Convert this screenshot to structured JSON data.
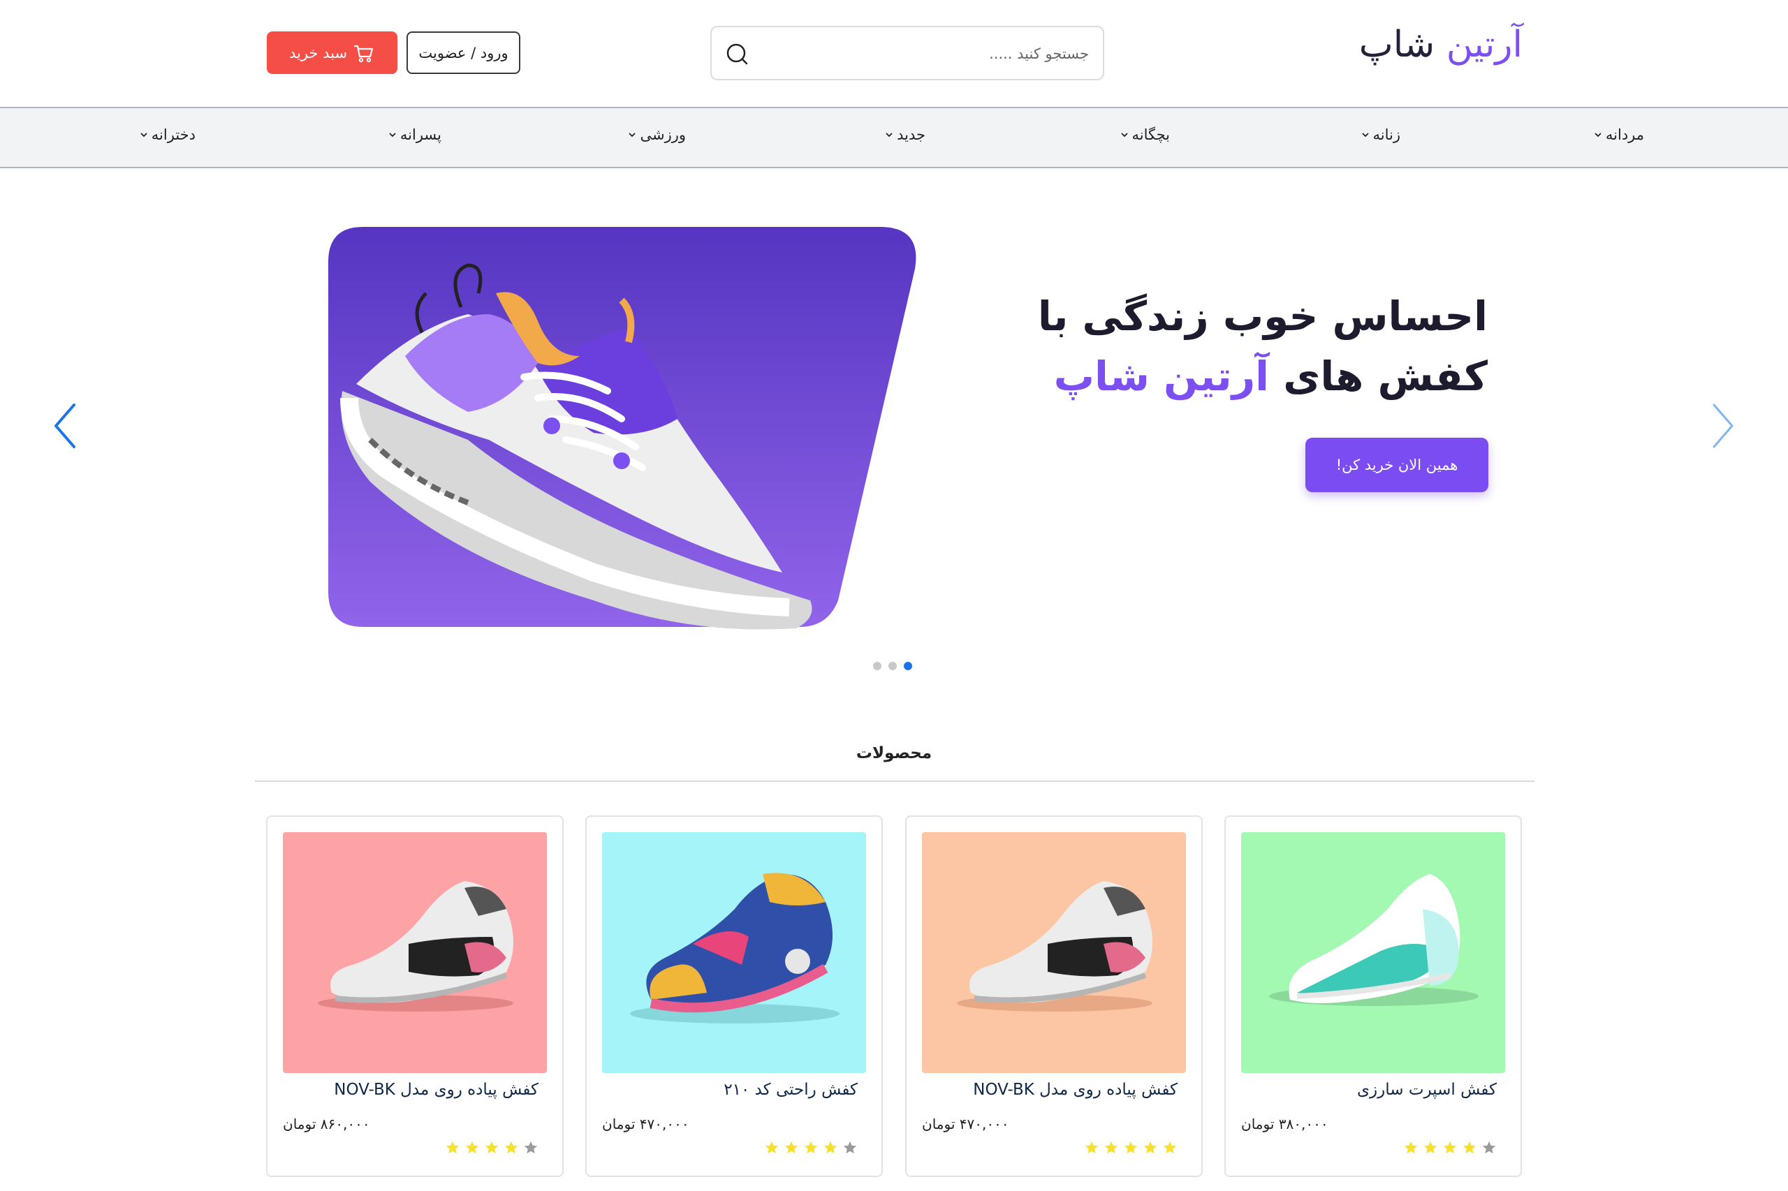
{
  "colors": {
    "accent": "#7b4ff0",
    "cart": "#f54e47",
    "star_filled": "#f7e02d",
    "star_empty": "#9a9a9a",
    "dot_active": "#1a73e8"
  },
  "header": {
    "logo_part1": "آرتین",
    "logo_part2": "شاپ",
    "search_placeholder": "جستجو کنید .....",
    "login_label": "ورود / عضویت",
    "cart_label": "سبد خرید"
  },
  "nav": {
    "items": [
      {
        "label": "مردانه"
      },
      {
        "label": "زنانه"
      },
      {
        "label": "بچگانه"
      },
      {
        "label": "جدید"
      },
      {
        "label": "ورزشی"
      },
      {
        "label": "پسرانه"
      },
      {
        "label": "دخترانه"
      }
    ]
  },
  "hero": {
    "title_line1": "احساس خوب زندگی با",
    "title_line2_prefix": "کفش های",
    "title_line2_accent": "آرتین شاپ",
    "cta_label": "همین الان خرید کن!",
    "slide_count": 3,
    "active_slide": 3
  },
  "products": {
    "section_title": "محصولات",
    "items": [
      {
        "name": "کفش اسپرت سارزی",
        "price": "۳۸۰,۰۰۰ تومان",
        "rating": 4,
        "bg_color": "#a3f9b1"
      },
      {
        "name": "کفش پیاده روی مدل NOV-BK",
        "price": "۴۷۰,۰۰۰ تومان",
        "rating": 5,
        "bg_color": "#fcc5a4"
      },
      {
        "name": "کفش راحتی کد ۲۱۰",
        "price": "۴۷۰,۰۰۰ تومان",
        "rating": 4,
        "bg_color": "#a4f4f9"
      },
      {
        "name": "کفش پیاده روی مدل NOV-BK",
        "price": "۸۶۰,۰۰۰ تومان",
        "rating": 4,
        "bg_color": "#fda3a5"
      }
    ]
  }
}
